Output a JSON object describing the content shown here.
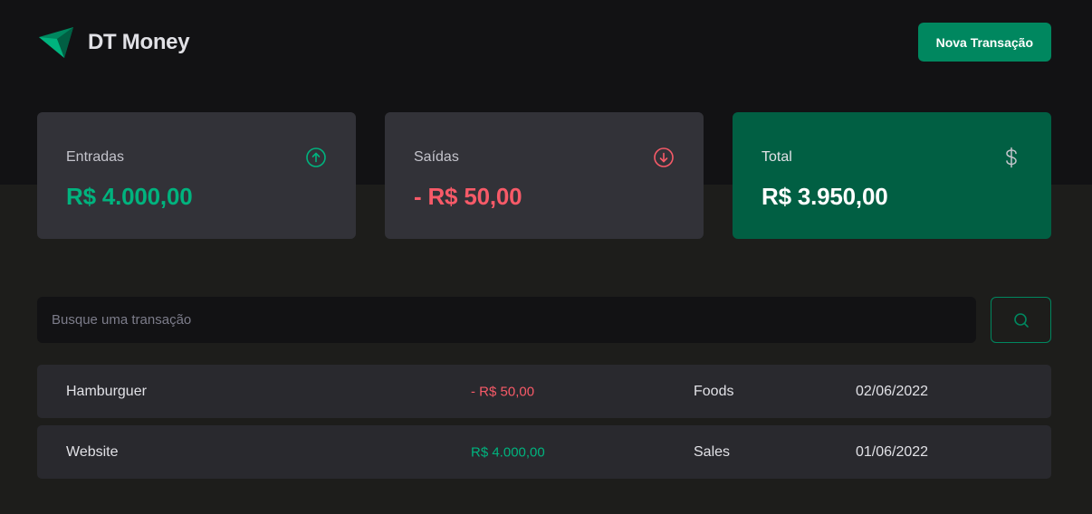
{
  "header": {
    "app_name": "DT Money",
    "new_transaction_label": "Nova Transação"
  },
  "summary": {
    "income": {
      "label": "Entradas",
      "value": "R$ 4.000,00",
      "icon": "arrow-circle-up-icon"
    },
    "outcome": {
      "label": "Saídas",
      "value": "- R$ 50,00",
      "icon": "arrow-circle-down-icon"
    },
    "total": {
      "label": "Total",
      "value": "R$ 3.950,00",
      "icon": "currency-dollar-icon"
    }
  },
  "search": {
    "placeholder": "Busque uma transação",
    "value": "",
    "icon": "magnifying-glass-icon"
  },
  "transactions": [
    {
      "description": "Hamburguer",
      "price": "- R$ 50,00",
      "type": "outcome",
      "category": "Foods",
      "date": "02/06/2022"
    },
    {
      "description": "Website",
      "price": "R$ 4.000,00",
      "type": "income",
      "category": "Sales",
      "date": "01/06/2022"
    }
  ],
  "colors": {
    "brand_green": "#00875f",
    "income_green": "#00b37e",
    "outcome_red": "#f75a68",
    "total_card": "#015f43"
  }
}
